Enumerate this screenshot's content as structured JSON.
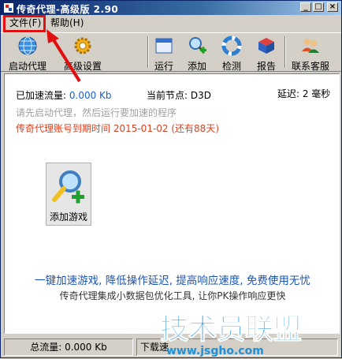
{
  "window": {
    "title": "传奇代理-高级版 2.90"
  },
  "titlebar_buttons": {
    "minimize": "_",
    "maximize": "□",
    "close": "×"
  },
  "menu": {
    "file": "文件(F)",
    "help": "帮助(H)"
  },
  "toolbar": {
    "start_proxy": "启动代理",
    "advanced_settings": "高级设置",
    "run": "运行",
    "add": "添加",
    "detect": "检测",
    "report": "报告",
    "contact_support": "联系客服"
  },
  "main": {
    "accelerated_traffic_label": "已加速流量:",
    "accelerated_traffic_value": "0.000 Kb",
    "current_node_label": "当前节点:",
    "current_node_value": "D3D",
    "latency": "延迟: 2 毫秒",
    "hint": "请先启动代理，然后运行要加速的程序",
    "expiry": "传奇代理账号到期时间 2015-01-02 (还有88天)",
    "add_game": "添加游戏",
    "slogan": "一键加速游戏, 降低操作延迟, 提高响应速度, 免费使用无忧",
    "sub_slogan": "传奇代理集成小数据包优化工具, 让你PK操作响应更快"
  },
  "statusbar": {
    "total_traffic": "总流量: 0.000 Kb",
    "download_prefix": "下载速"
  },
  "watermark": {
    "title": "技术员联盟",
    "url": "www.jsgho.com"
  },
  "colors": {
    "accent_red": "#e01010",
    "link_blue": "#1c55b0",
    "expiry_red": "#e04020",
    "watermark_blue": "#1f8fd6"
  }
}
